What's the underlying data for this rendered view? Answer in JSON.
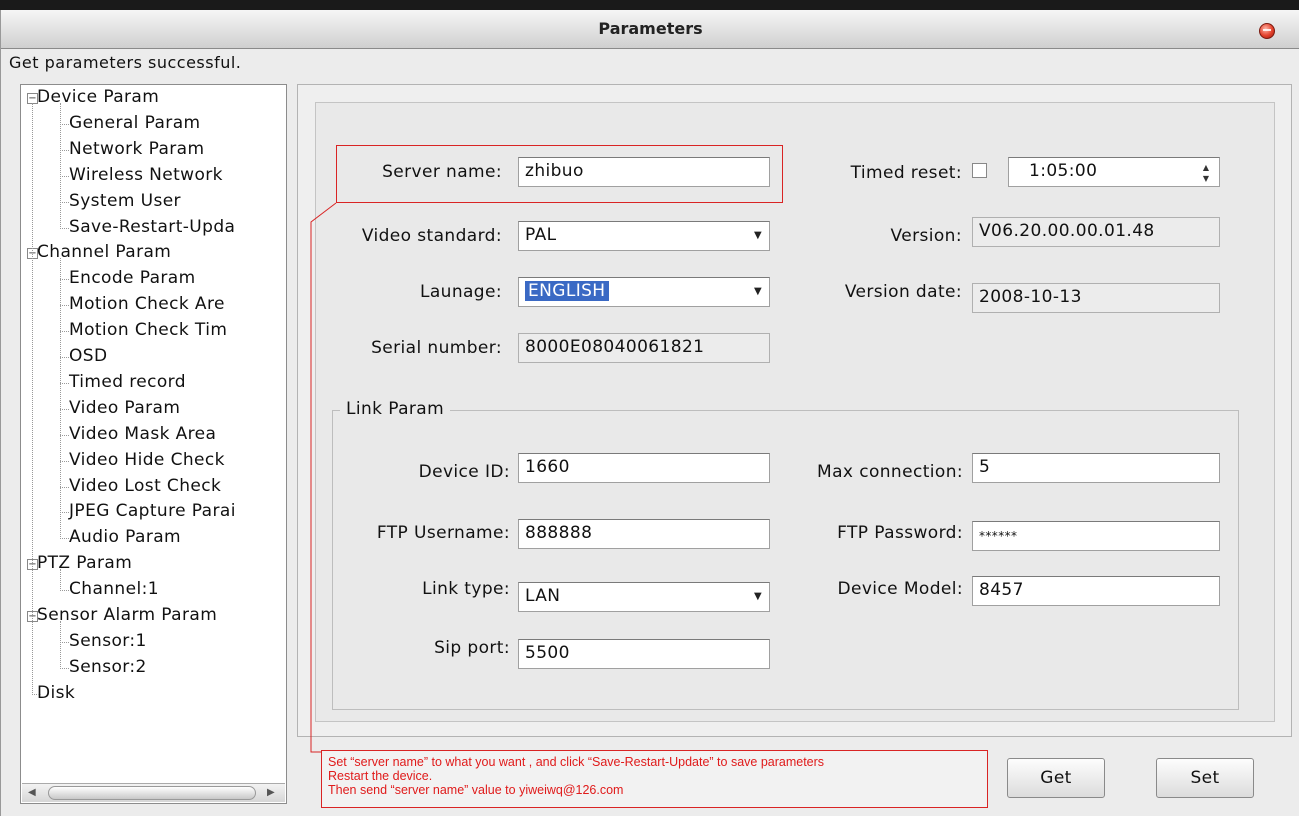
{
  "window": {
    "title": "Parameters"
  },
  "status": "Get parameters successful.",
  "tree": [
    {
      "label": "Device Param",
      "type": "group",
      "expander": "−"
    },
    {
      "label": "General Param",
      "type": "leaf"
    },
    {
      "label": "Network Param",
      "type": "leaf"
    },
    {
      "label": "Wireless Network",
      "type": "leaf"
    },
    {
      "label": "System User",
      "type": "leaf"
    },
    {
      "label": "Save-Restart-Upda",
      "type": "leaf"
    },
    {
      "label": "Channel Param",
      "type": "group",
      "expander": "−"
    },
    {
      "label": "Encode Param",
      "type": "leaf"
    },
    {
      "label": "Motion Check Are",
      "type": "leaf"
    },
    {
      "label": "Motion Check Tim",
      "type": "leaf"
    },
    {
      "label": "OSD",
      "type": "leaf"
    },
    {
      "label": "Timed record",
      "type": "leaf"
    },
    {
      "label": "Video Param",
      "type": "leaf"
    },
    {
      "label": "Video Mask Area",
      "type": "leaf"
    },
    {
      "label": "Video Hide Check",
      "type": "leaf"
    },
    {
      "label": "Video Lost Check",
      "type": "leaf"
    },
    {
      "label": "JPEG Capture Parai",
      "type": "leaf"
    },
    {
      "label": "Audio Param",
      "type": "leaf"
    },
    {
      "label": "PTZ Param",
      "type": "group",
      "expander": "−"
    },
    {
      "label": "Channel:1",
      "type": "leaf"
    },
    {
      "label": "Sensor Alarm Param",
      "type": "group",
      "expander": "−"
    },
    {
      "label": "Sensor:1",
      "type": "leaf"
    },
    {
      "label": "Sensor:2",
      "type": "leaf"
    },
    {
      "label": "Disk",
      "type": "root-leaf"
    }
  ],
  "scroll": {
    "left_icon": "◀",
    "right_icon": "▶"
  },
  "form": {
    "server_name_label": "Server name:",
    "server_name_value": "zhibuo",
    "video_standard_label": "Video standard:",
    "video_standard_value": "PAL",
    "language_label": "Launage:",
    "language_value": "ENGLISH",
    "serial_label": "Serial number:",
    "serial_value": "8000E08040061821",
    "timed_reset_label": "Timed reset:",
    "timed_reset_value": "1:05:00",
    "version_label": "Version:",
    "version_value": "V06.20.00.00.01.48",
    "version_date_label": "Version date:",
    "version_date_value": "2008-10-13",
    "dropdown_icon": "▼",
    "spin_up": "▲",
    "spin_down": "▼"
  },
  "link": {
    "legend": "Link Param",
    "device_id_label": "Device ID:",
    "device_id_value": "1660",
    "max_conn_label": "Max connection:",
    "max_conn_value": "5",
    "ftp_user_label": "FTP Username:",
    "ftp_user_value": "888888",
    "ftp_pass_label": "FTP Password:",
    "ftp_pass_value": "******",
    "link_type_label": "Link type:",
    "link_type_value": "LAN",
    "device_model_label": "Device Model:",
    "device_model_value": "8457",
    "sip_port_label": "Sip port:",
    "sip_port_value": "5500"
  },
  "note": [
    "Set “server name” to what you want , and click “Save-Restart-Update” to save parameters",
    "Restart the device.",
    "Then send “server name” value to yiweiwq@126.com"
  ],
  "buttons": {
    "get": "Get",
    "set": "Set"
  },
  "colors": {
    "annotation": "#e01b1b",
    "selection": "#3a69c4"
  }
}
